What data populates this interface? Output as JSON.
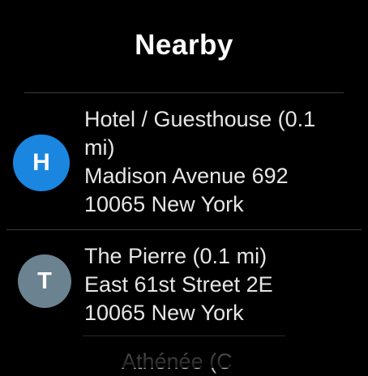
{
  "header": {
    "title": "Nearby"
  },
  "places": [
    {
      "icon_letter": "H",
      "icon_color": "#1a86e0",
      "name_line1": "Hotel / Guesthouse (0.1",
      "name_line2": "mi)",
      "address_line1": "Madison Avenue 692",
      "address_line2": "10065 New York"
    },
    {
      "icon_letter": "T",
      "icon_color": "#6b8290",
      "name_line1": "The Pierre (0.1 mi)",
      "address_line1": "East 61st Street 2E",
      "address_line2": "10065 New York"
    },
    {
      "name_partial": "Athénée (C"
    }
  ]
}
